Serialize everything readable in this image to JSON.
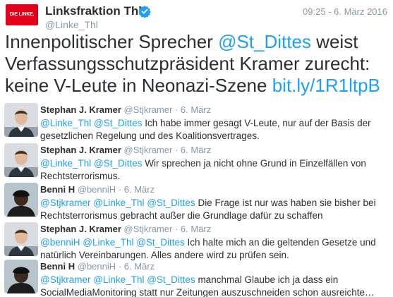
{
  "header": {
    "logo_text": "DIE LINKE.",
    "display_name": "Linksfraktion Thl",
    "handle": "@Linke_Thl",
    "timestamp": "09:25 - 6. März 2016"
  },
  "tweet": {
    "part1": "Innenpolitischer Sprecher ",
    "mention": "@St_Dittes",
    "part2": " weist Verfassungsschutzpräsident Kramer zurecht: keine V-Leute in Neonazi-Szene ",
    "link": "bit.ly/1R1ltpB"
  },
  "replies": [
    {
      "name": "Stephan J. Kramer",
      "handle": "@Stjkramer",
      "date": "6. März",
      "mentions": "@Linke_Thl @St_Dittes",
      "text": " Ich habe immer gesagt V-Leute, nur auf der Basis der gesetzlichen Regelung und des Koalitionsvertrages."
    },
    {
      "name": "Stephan J. Kramer",
      "handle": "@Stjkramer",
      "date": "6. März",
      "mentions": "@Linke_Thl @St_Dittes",
      "text": " Wir sprechen ja nicht ohne Grund in Einzelfällen von Rechtsterrorismus."
    },
    {
      "name": "Benni H",
      "handle": "@benniH",
      "date": "6. März",
      "mentions": "@Stjkramer @Linke_Thl @St_Dittes",
      "text": " Die Frage ist nur was haben sie bisher bei Rechtsterrorismus gebracht außer die Grundlage dafür zu schaffen"
    },
    {
      "name": "Stephan J. Kramer",
      "handle": "@Stjkramer",
      "date": "6. März",
      "mentions": "@benniH @Linke_Thl @St_Dittes",
      "text": " Ich halte mich an die geltenden Gesetze und natürlich Vereinbarungen. Alles andere wird zu prüfen sein."
    },
    {
      "name": "Benni H",
      "handle": "@benniH",
      "date": "6. März",
      "mentions": "@Stjkramer @Linke_Thl @St_Dittes",
      "text": " manchmal Glaube ich ja dass ein SocialMediaMonitoring statt nur Zeitungen auszuschneiden schon ausreichte…"
    }
  ],
  "separator": "·",
  "colors": {
    "brand": "#e2001a",
    "link": "#1da1f2",
    "muted": "#8899a6",
    "text": "#292f33"
  }
}
